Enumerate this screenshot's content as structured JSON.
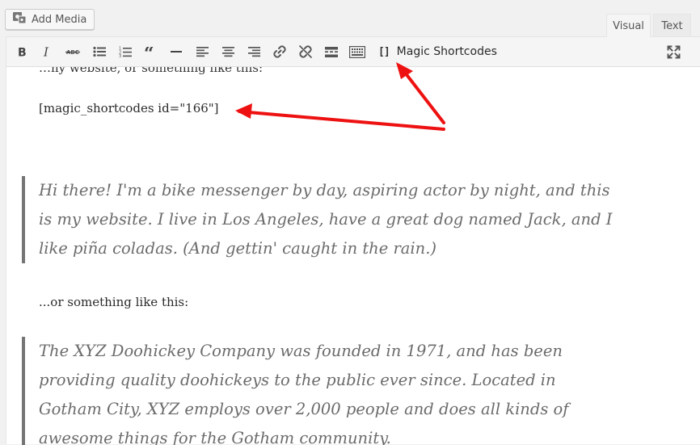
{
  "media": {
    "add_media_label": "Add Media",
    "icon": "media-icon"
  },
  "tabs": {
    "visual_label": "Visual",
    "text_label": "Text"
  },
  "toolbar": {
    "bold_icon": "bold-icon",
    "italic_icon": "italic-icon",
    "strikethrough_icon": "strikethrough-icon",
    "bullet_list_icon": "bullet-list-icon",
    "numbered_list_icon": "numbered-list-icon",
    "blockquote_icon": "blockquote-icon",
    "hr_icon": "horizontal-rule-icon",
    "align_left_icon": "align-left-icon",
    "align_center_icon": "align-center-icon",
    "align_right_icon": "align-right-icon",
    "link_icon": "link-icon",
    "unlink_icon": "unlink-icon",
    "read_more_icon": "read-more-icon",
    "toolbar_toggle_icon": "keyboard-icon",
    "magic_bracket": "[]",
    "magic_label": "Magic Shortcodes",
    "fullscreen_icon": "fullscreen-icon"
  },
  "content": {
    "cut_line": "…ny website, or something like this:",
    "shortcode": "[magic_shortcodes id=\"166\"]",
    "quote1_lines": [
      "Hi there! I'm a bike messenger by day, aspiring actor by night, and this",
      "is my website. I live in Los Angeles, have a great dog named Jack, and I",
      "like piña coladas. (And gettin' caught in the rain.)"
    ],
    "or_line": "...or something like this:",
    "quote2_lines": [
      "The XYZ Doohickey Company was founded in 1971, and has been",
      "providing quality doohickeys to the public ever since. Located in",
      "Gotham City, XYZ employs over 2,000 people and does all kinds of",
      "awesome things for the Gotham community."
    ]
  },
  "colors": {
    "annotation_arrow": "#ee1111",
    "quote_border": "#757575",
    "toolbar_bg": "#f5f5f5"
  }
}
